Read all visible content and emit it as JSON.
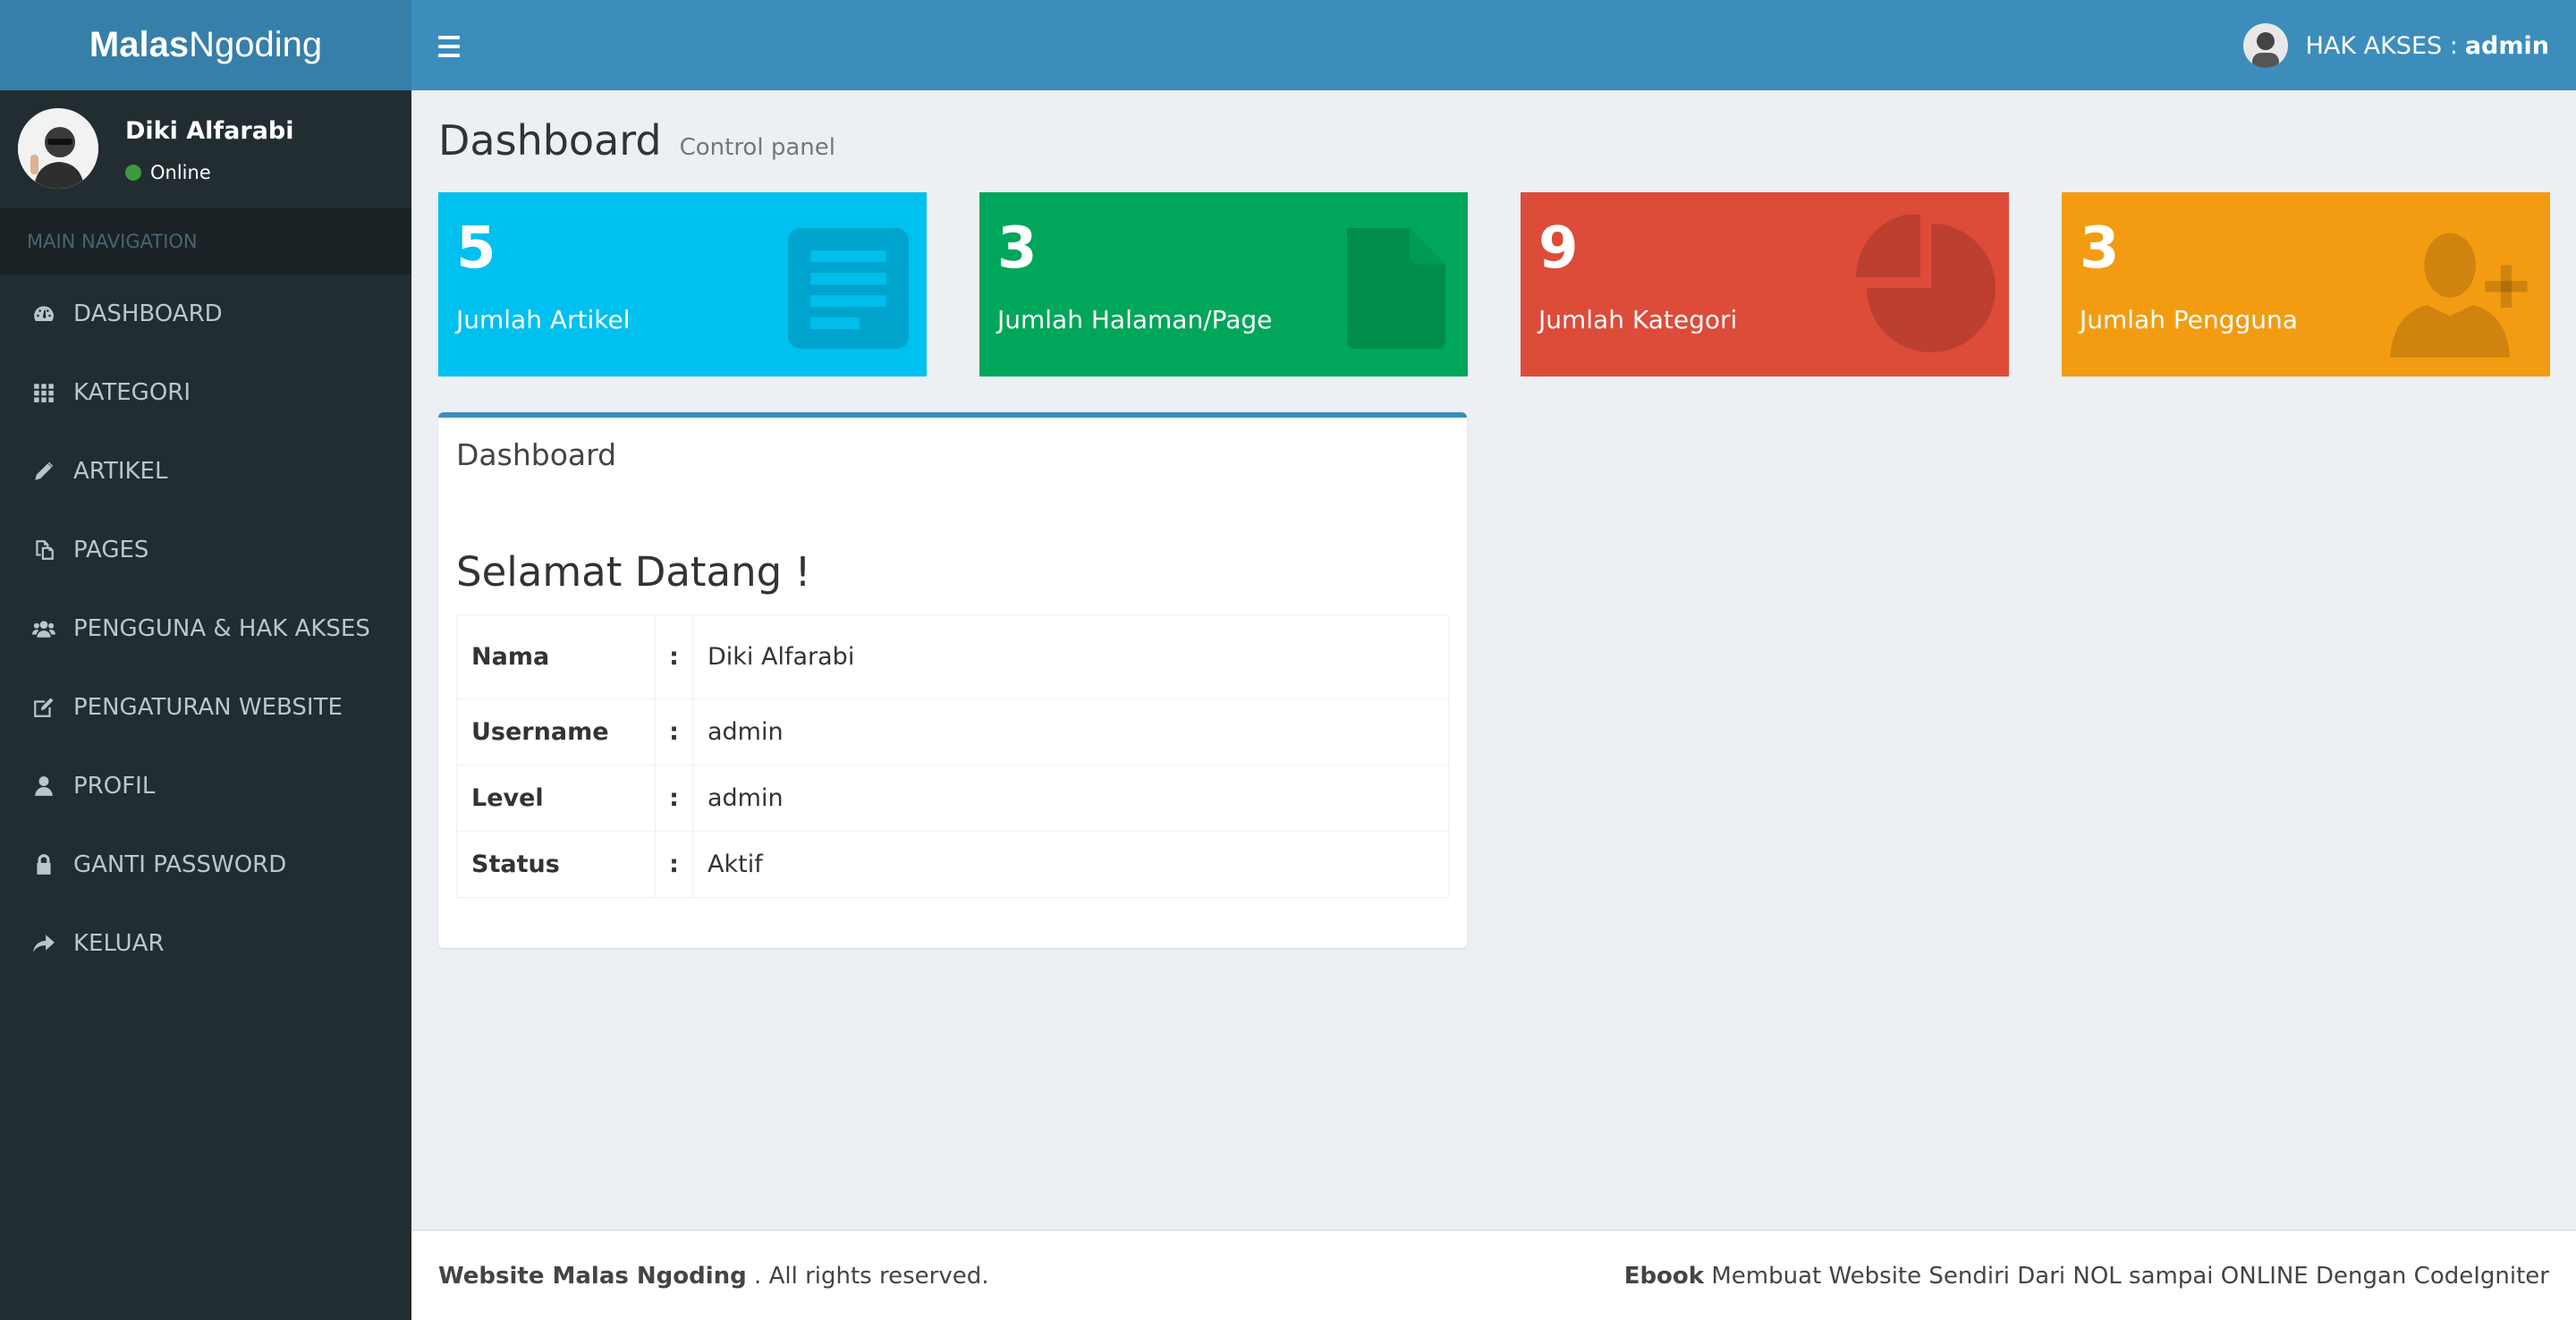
{
  "header": {
    "logo_bold": "Malas",
    "logo_light": "Ngoding",
    "user_label": "HAK AKSES :",
    "user_role": "admin"
  },
  "sidebar": {
    "user_name": "Diki Alfarabi",
    "user_status": "Online",
    "nav_header": "MAIN NAVIGATION",
    "items": [
      {
        "label": "DASHBOARD",
        "icon": "dashboard-icon"
      },
      {
        "label": "KATEGORI",
        "icon": "grid-icon"
      },
      {
        "label": "ARTIKEL",
        "icon": "pencil-icon"
      },
      {
        "label": "PAGES",
        "icon": "copy-icon"
      },
      {
        "label": "PENGGUNA & HAK AKSES",
        "icon": "users-icon"
      },
      {
        "label": "PENGATURAN WEBSITE",
        "icon": "edit-icon"
      },
      {
        "label": "PROFIL",
        "icon": "user-icon"
      },
      {
        "label": "GANTI PASSWORD",
        "icon": "lock-icon"
      },
      {
        "label": "KELUAR",
        "icon": "share-icon"
      }
    ]
  },
  "content": {
    "title": "Dashboard",
    "subtitle": "Control panel"
  },
  "stats": [
    {
      "value": "5",
      "label": "Jumlah Artikel",
      "color": "#00c0ef",
      "icon": "document-lines-icon"
    },
    {
      "value": "3",
      "label": "Jumlah Halaman/Page",
      "color": "#00a65a",
      "icon": "file-icon"
    },
    {
      "value": "9",
      "label": "Jumlah Kategori",
      "color": "#dd4b39",
      "icon": "pie-chart-icon"
    },
    {
      "value": "3",
      "label": "Jumlah Pengguna",
      "color": "#f39c12",
      "icon": "user-plus-icon"
    }
  ],
  "panel": {
    "title": "Dashboard",
    "welcome": "Selamat Datang !",
    "rows": [
      {
        "key": "Nama",
        "sep": ":",
        "value": "Diki Alfarabi"
      },
      {
        "key": "Username",
        "sep": ":",
        "value": "admin"
      },
      {
        "key": "Level",
        "sep": ":",
        "value": "admin"
      },
      {
        "key": "Status",
        "sep": ":",
        "value": "Aktif"
      }
    ]
  },
  "footer": {
    "left_bold": "Website Malas Ngoding",
    "left_text": ". All rights reserved.",
    "right_bold": "Ebook",
    "right_text": "Membuat Website Sendiri Dari NOL sampai ONLINE Dengan CodeIgniter"
  },
  "colors": {
    "header_dark": "#367fa9",
    "header": "#3c8dbc",
    "sidebar": "#222d32",
    "status_online": "#3c9a3c"
  }
}
